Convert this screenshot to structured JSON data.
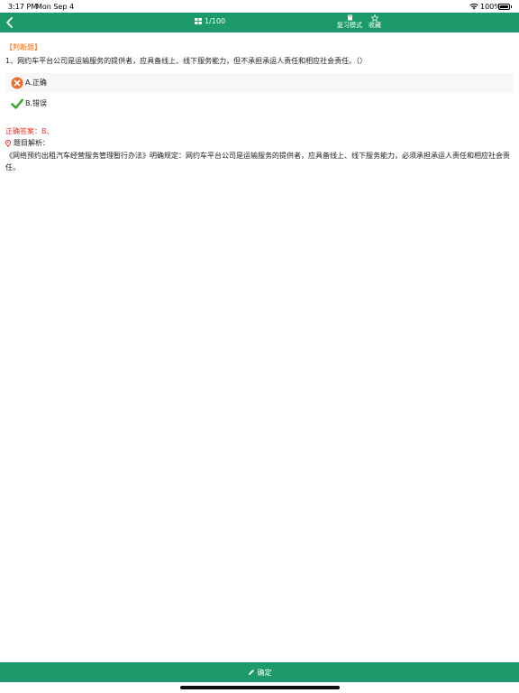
{
  "status_bar": {
    "time": "3:17 PM",
    "date": "Mon Sep 4",
    "battery": "100%"
  },
  "navbar": {
    "counter": "1/100",
    "review_mode_label": "复习模式",
    "favorite_label": "收藏"
  },
  "question": {
    "type": "【判断题】",
    "text": "1、网约车平台公司是运输服务的提供者，应具备线上、线下服务能力，但不承担承运人责任和相应社会责任。（）",
    "options": [
      {
        "label": "A.正确",
        "state": "wrong-selected"
      },
      {
        "label": "B.错误",
        "state": "correct"
      }
    ]
  },
  "answer": {
    "text": "正确答案：B、"
  },
  "analysis": {
    "title": "题目解析：",
    "text": "《网络预约出租汽车经营服务管理暂行办法》明确规定：网约车平台公司是运输服务的提供者，应具备线上、线下服务能力，必须承担承运人责任和相应社会责任。"
  },
  "footer": {
    "confirm_label": "确定"
  },
  "colors": {
    "brand": "#1d9a6c",
    "qtype": "#ff6600",
    "answer": "#e8332d",
    "wrong_icon": "#f06a2a",
    "correct_icon": "#3aaa35"
  }
}
